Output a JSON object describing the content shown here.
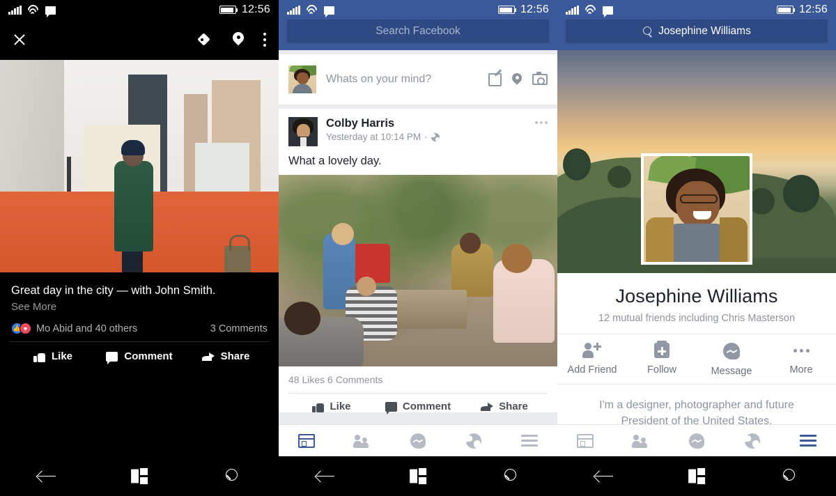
{
  "status_bar": {
    "time": "12:56",
    "icons": [
      "signal-bars",
      "wifi",
      "message",
      "battery"
    ]
  },
  "system_nav": {
    "back": "back",
    "start": "windows-start",
    "search": "search"
  },
  "panel_photo_viewer": {
    "appbar": {
      "close": "close",
      "tag": "tag-people",
      "location": "check-in",
      "more": "more-options"
    },
    "photo_alt": "Man in green coat on rooftop overlooking city skyline",
    "caption": "Great day in the city — with John Smith.",
    "see_more": "See More",
    "reactions_text": "Mo Abid and 40 others",
    "comments_count": "3 Comments",
    "actions": [
      {
        "label": "Like",
        "icon": "thumbs-up-icon"
      },
      {
        "label": "Comment",
        "icon": "comment-bubble-icon"
      },
      {
        "label": "Share",
        "icon": "share-arrow-icon"
      }
    ]
  },
  "panel_news_feed": {
    "search": {
      "placeholder": "Search Facebook"
    },
    "composer": {
      "placeholder": "Whats on your mind?",
      "avatar_alt": "Your profile photo",
      "icons": [
        "compose-icon",
        "location-pin-icon",
        "camera-icon"
      ]
    },
    "post": {
      "author": "Colby Harris",
      "timestamp": "Yesterday at 10:14 PM",
      "privacy_icon": "globe-icon",
      "more_icon": "more-options-icon",
      "text": "What a lovely day.",
      "photo_alt": "Group of friends relaxing in a plant-filled courtyard",
      "stats": "48 Likes  6 Comments",
      "actions": [
        {
          "label": "Like",
          "icon": "thumbs-up-icon"
        },
        {
          "label": "Comment",
          "icon": "comment-bubble-icon"
        },
        {
          "label": "Share",
          "icon": "share-arrow-icon"
        }
      ]
    },
    "bottom_nav": [
      {
        "name": "news-feed",
        "icon": "news-feed-icon",
        "active": true
      },
      {
        "name": "friend-requests",
        "icon": "friends-icon",
        "active": false
      },
      {
        "name": "messenger",
        "icon": "messenger-icon",
        "active": false
      },
      {
        "name": "notifications",
        "icon": "globe-icon",
        "active": false
      },
      {
        "name": "menu",
        "icon": "hamburger-icon",
        "active": false
      }
    ]
  },
  "panel_profile": {
    "search": {
      "value": "Josephine Williams",
      "icon": "search-icon"
    },
    "cover_alt": "Rolling green hills at sunset",
    "profile_photo_alt": "Josephine Williams smiling",
    "name": "Josephine Williams",
    "mutual_friends": "12 mutual friends including Chris Masterson",
    "actions": [
      {
        "label": "Add Friend",
        "icon": "add-friend-icon"
      },
      {
        "label": "Follow",
        "icon": "follow-icon"
      },
      {
        "label": "Message",
        "icon": "messenger-icon"
      },
      {
        "label": "More",
        "icon": "more-dots-icon"
      }
    ],
    "bio": "I'm a designer, photographer and future President of the United States.",
    "bottom_nav": [
      {
        "name": "news-feed",
        "icon": "news-feed-icon",
        "active": false
      },
      {
        "name": "friend-requests",
        "icon": "friends-icon",
        "active": false
      },
      {
        "name": "messenger",
        "icon": "messenger-icon",
        "active": false
      },
      {
        "name": "notifications",
        "icon": "globe-icon",
        "active": false
      },
      {
        "name": "menu",
        "icon": "hamburger-icon",
        "active": true
      }
    ]
  },
  "colors": {
    "brand_blue": "#3b5998",
    "search_field": "#2f4a83",
    "feed_bg": "#e9ebee",
    "like_badge": "#3b7ee0",
    "love_badge": "#f24b5e"
  }
}
